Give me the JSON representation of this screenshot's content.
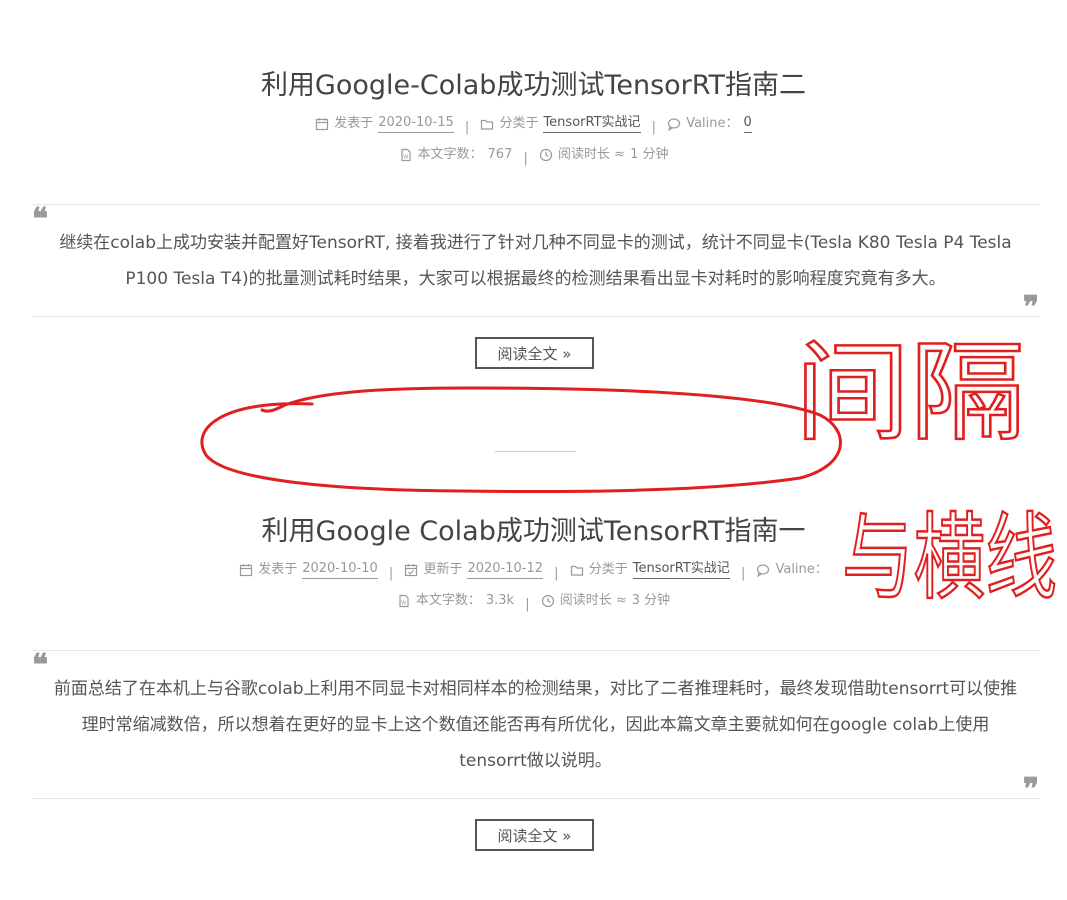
{
  "posts": [
    {
      "title": "利用Google-Colab成功测试TensorRT指南二",
      "meta1": {
        "published_label": "发表于",
        "published_date": "2020-10-15",
        "category_label": "分类于",
        "category": "TensorRT实战记",
        "comments_label": "Valine：",
        "comments_count": "0"
      },
      "meta2": {
        "wordcount_label": "本文字数：",
        "wordcount": "767",
        "readtime_label": "阅读时长 ≈",
        "readtime": "1 分钟"
      },
      "excerpt_lines": [
        "继续在colab上成功安装并配置好TensorRT, 接着我进行了针对几种不同显卡的测试，统计不同显卡(Tesla K80 Tesla P4 Tesla",
        "P100 Tesla T4)的批量测试耗时结果，大家可以根据最终的检测结果看出显卡对耗时的影响程度究竟有多大。"
      ],
      "read_more": "阅读全文 »"
    },
    {
      "title": "利用Google Colab成功测试TensorRT指南一",
      "meta1": {
        "published_label": "发表于",
        "published_date": "2020-10-10",
        "updated_label": "更新于",
        "updated_date": "2020-10-12",
        "category_label": "分类于",
        "category": "TensorRT实战记",
        "comments_label": "Valine："
      },
      "meta2": {
        "wordcount_label": "本文字数：",
        "wordcount": "3.3k",
        "readtime_label": "阅读时长 ≈",
        "readtime": "3 分钟"
      },
      "excerpt_lines": [
        "前面总结了在本机上与谷歌colab上利用不同显卡对相同样本的检测结果，对比了二者推理耗时，最终发现借助tensorrt可以使推",
        "理时常缩减数倍，所以想着在更好的显卡上这个数值还能否再有所优化，因此本篇文章主要就如何在google colab上使用",
        "tensorrt做以说明。"
      ],
      "read_more": "阅读全文 »"
    }
  ],
  "quote_open": "❝",
  "quote_close": "❞",
  "separator": "|",
  "annotation": {
    "text_line1": "间隔",
    "text_line2": "与横线",
    "color": "#e02020"
  },
  "icons": [
    "calendar-icon",
    "calendar-check-icon",
    "folder-icon",
    "comment-icon",
    "file-word-icon",
    "clock-icon"
  ]
}
